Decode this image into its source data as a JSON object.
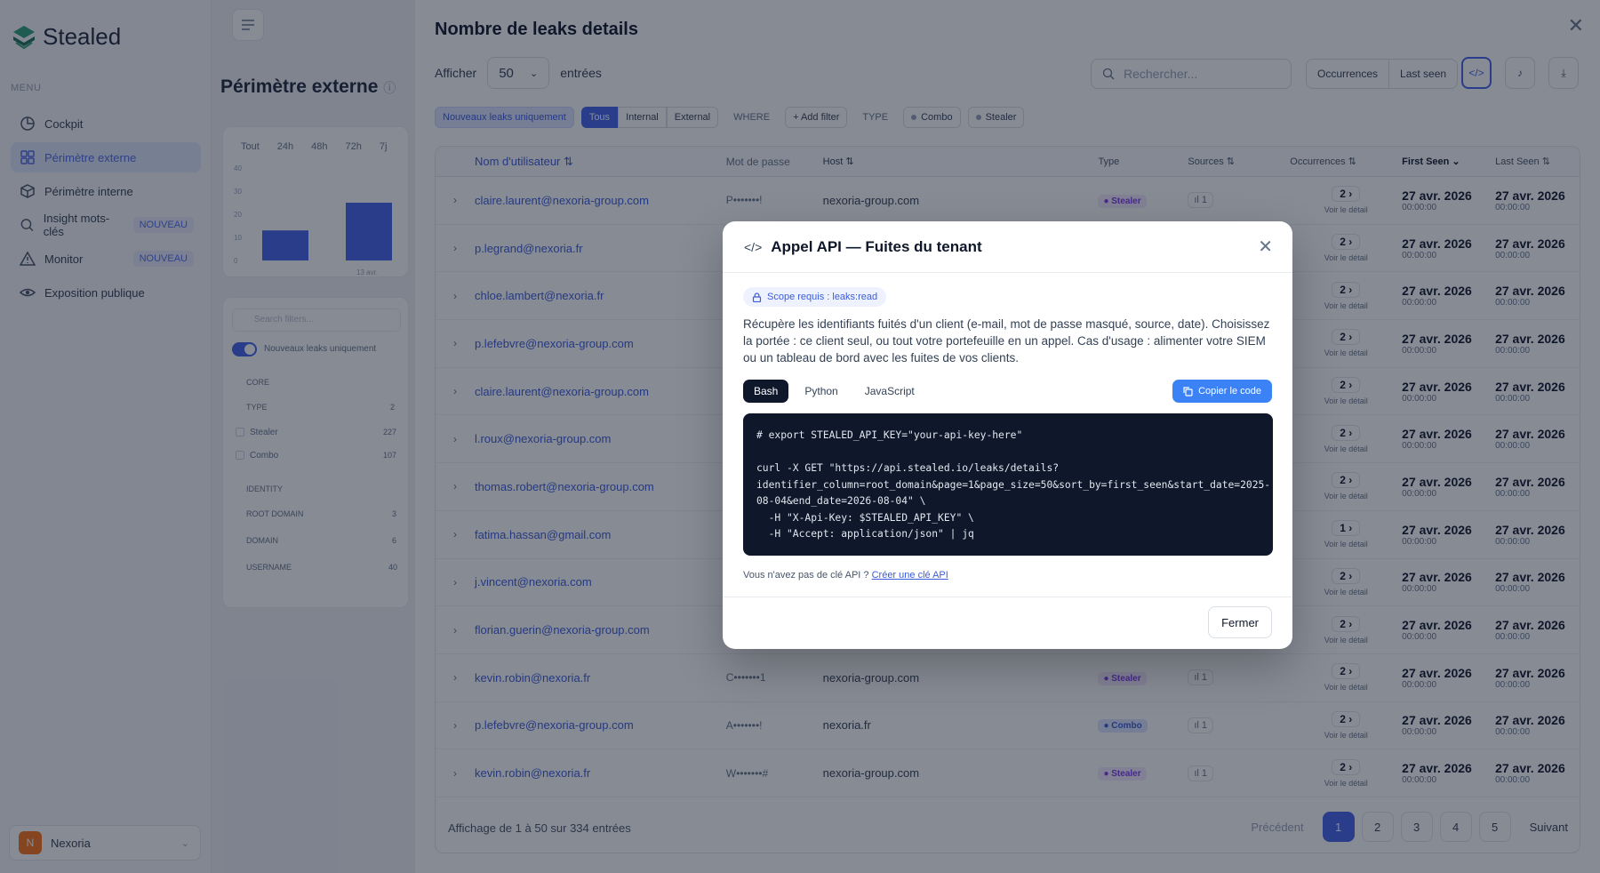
{
  "app": {
    "name": "Stealed",
    "menu_label": "MENU"
  },
  "nav": [
    {
      "label": "Cockpit",
      "icon": "pie-icon",
      "badge": "",
      "active": false
    },
    {
      "label": "Périmètre externe",
      "icon": "grid-icon",
      "badge": "",
      "active": true
    },
    {
      "label": "Périmètre interne",
      "icon": "box-icon",
      "badge": "",
      "active": false
    },
    {
      "label": "Insight mots-clés",
      "icon": "search-icon",
      "badge": "NOUVEAU",
      "active": false
    },
    {
      "label": "Monitor",
      "icon": "warning-icon",
      "badge": "NOUVEAU",
      "active": false
    },
    {
      "label": "Exposition publique",
      "icon": "eye-icon",
      "badge": "",
      "active": false
    }
  ],
  "account": {
    "initial": "N",
    "name": "Nexoria"
  },
  "middle": {
    "title": "Périmètre externe",
    "tabs": [
      "Tout",
      "24h",
      "48h",
      "72h",
      "7j"
    ],
    "y_ticks": [
      "40",
      "30",
      "20",
      "10",
      "0"
    ],
    "bar_label": "13 avr.",
    "bars": [
      {
        "value": 13
      },
      {
        "value": 25
      }
    ],
    "search_placeholder": "Search filters...",
    "toggle_label": "Nouveaux leaks uniquement",
    "sections": {
      "core": "CORE",
      "type": "TYPE",
      "type_count": "2",
      "stealer": "Stealer",
      "stealer_count": "227",
      "combo": "Combo",
      "combo_count": "107",
      "identity": "IDENTITY",
      "root_domain": "ROOT DOMAIN",
      "root_domain_count": "3",
      "domain": "DOMAIN",
      "domain_count": "6",
      "username": "USERNAME",
      "username_count": "40"
    }
  },
  "main": {
    "title": "Nombre de leaks details",
    "show_label": "Afficher",
    "page_size": "50",
    "entries_label": "entrées",
    "search_placeholder": "Rechercher...",
    "sort_buttons": [
      "Occurrences",
      "Last seen"
    ],
    "chips": {
      "new_only": "Nouveaux leaks uniquement",
      "all": "Tous",
      "internal": "Internal",
      "external": "External",
      "where": "WHERE",
      "add_filter": "+ Add filter",
      "type": "TYPE",
      "combo": "Combo",
      "stealer": "Stealer"
    },
    "columns": [
      "Nom d'utilisateur",
      "Mot de passe",
      "Host",
      "Type",
      "Sources",
      "Occurrences",
      "First Seen",
      "Last Seen"
    ],
    "detail_label": "Voir le détail",
    "rows": [
      {
        "user": "claire.laurent@nexoria-group.com",
        "pwd": "P•••••••!",
        "host": "nexoria-group.com",
        "type": "Stealer",
        "src": "1",
        "occ": "2",
        "first": "27 avr. 2026",
        "first_t": "00:00:00",
        "last": "27 avr. 2026",
        "last_t": "00:00:00"
      },
      {
        "user": "p.legrand@nexoria.fr",
        "pwd": "",
        "host": "",
        "type": "",
        "src": "",
        "occ": "2",
        "first": "27 avr. 2026",
        "first_t": "00:00:00",
        "last": "27 avr. 2026",
        "last_t": "00:00:00"
      },
      {
        "user": "chloe.lambert@nexoria.fr",
        "pwd": "",
        "host": "",
        "type": "",
        "src": "",
        "occ": "2",
        "first": "27 avr. 2026",
        "first_t": "00:00:00",
        "last": "27 avr. 2026",
        "last_t": "00:00:00"
      },
      {
        "user": "p.lefebvre@nexoria-group.com",
        "pwd": "",
        "host": "",
        "type": "",
        "src": "",
        "occ": "2",
        "first": "27 avr. 2026",
        "first_t": "00:00:00",
        "last": "27 avr. 2026",
        "last_t": "00:00:00"
      },
      {
        "user": "claire.laurent@nexoria-group.com",
        "pwd": "",
        "host": "",
        "type": "",
        "src": "",
        "occ": "2",
        "first": "27 avr. 2026",
        "first_t": "00:00:00",
        "last": "27 avr. 2026",
        "last_t": "00:00:00"
      },
      {
        "user": "l.roux@nexoria-group.com",
        "pwd": "",
        "host": "",
        "type": "",
        "src": "",
        "occ": "2",
        "first": "27 avr. 2026",
        "first_t": "00:00:00",
        "last": "27 avr. 2026",
        "last_t": "00:00:00"
      },
      {
        "user": "thomas.robert@nexoria-group.com",
        "pwd": "",
        "host": "",
        "type": "",
        "src": "",
        "occ": "2",
        "first": "27 avr. 2026",
        "first_t": "00:00:00",
        "last": "27 avr. 2026",
        "last_t": "00:00:00"
      },
      {
        "user": "fatima.hassan@gmail.com",
        "pwd": "",
        "host": "",
        "type": "",
        "src": "",
        "occ": "1",
        "first": "27 avr. 2026",
        "first_t": "00:00:00",
        "last": "27 avr. 2026",
        "last_t": "00:00:00"
      },
      {
        "user": "j.vincent@nexoria.com",
        "pwd": "",
        "host": "",
        "type": "",
        "src": "",
        "occ": "2",
        "first": "27 avr. 2026",
        "first_t": "00:00:00",
        "last": "27 avr. 2026",
        "last_t": "00:00:00"
      },
      {
        "user": "florian.guerin@nexoria-group.com",
        "pwd": "",
        "host": "",
        "type": "",
        "src": "",
        "occ": "2",
        "first": "27 avr. 2026",
        "first_t": "00:00:00",
        "last": "27 avr. 2026",
        "last_t": "00:00:00"
      },
      {
        "user": "kevin.robin@nexoria.fr",
        "pwd": "C•••••••1",
        "host": "nexoria-group.com",
        "type": "Stealer",
        "src": "1",
        "occ": "2",
        "first": "27 avr. 2026",
        "first_t": "00:00:00",
        "last": "27 avr. 2026",
        "last_t": "00:00:00"
      },
      {
        "user": "p.lefebvre@nexoria-group.com",
        "pwd": "A•••••••!",
        "host": "nexoria.fr",
        "type": "Combo",
        "src": "1",
        "occ": "2",
        "first": "27 avr. 2026",
        "first_t": "00:00:00",
        "last": "27 avr. 2026",
        "last_t": "00:00:00"
      },
      {
        "user": "kevin.robin@nexoria.fr",
        "pwd": "W•••••••#",
        "host": "nexoria-group.com",
        "type": "Stealer",
        "src": "1",
        "occ": "2",
        "first": "27 avr. 2026",
        "first_t": "00:00:00",
        "last": "27 avr. 2026",
        "last_t": "00:00:00"
      }
    ],
    "footer": {
      "summary": "Affichage de 1 à 50 sur 334 entrées",
      "prev": "Précédent",
      "pages": [
        "1",
        "2",
        "3",
        "4",
        "5"
      ],
      "next": "Suivant"
    }
  },
  "modal": {
    "title": "Appel API — Fuites du tenant",
    "scope": "Scope requis : leaks:read",
    "description": "Récupère les identifiants fuités d'un client (e-mail, mot de passe masqué, source, date). Choisissez la portée : ce client seul, ou tout votre portefeuille en un appel. Cas d'usage : alimenter votre SIEM ou un tableau de bord avec les fuites de vos clients.",
    "tabs": [
      "Bash",
      "Python",
      "JavaScript"
    ],
    "copy_label": "Copier le code",
    "code": "# export STEALED_API_KEY=\"your-api-key-here\"\n\ncurl -X GET \"https://api.stealed.io/leaks/details?\nidentifier_column=root_domain&page=1&page_size=50&sort_by=first_seen&start_date=2025-\n08-04&end_date=2026-08-04\" \\\n  -H \"X-Api-Key: $STEALED_API_KEY\" \\\n  -H \"Accept: application/json\" | jq",
    "no_key_text": "Vous n'avez pas de clé API ?",
    "create_key_link": "Créer une clé API",
    "close_label": "Fermer"
  },
  "colors": {
    "accent": "#4263eb",
    "stealer": "#7c3aed",
    "combo": "#3b5bdb",
    "overlay": "rgba(15,23,42,0.5)"
  }
}
